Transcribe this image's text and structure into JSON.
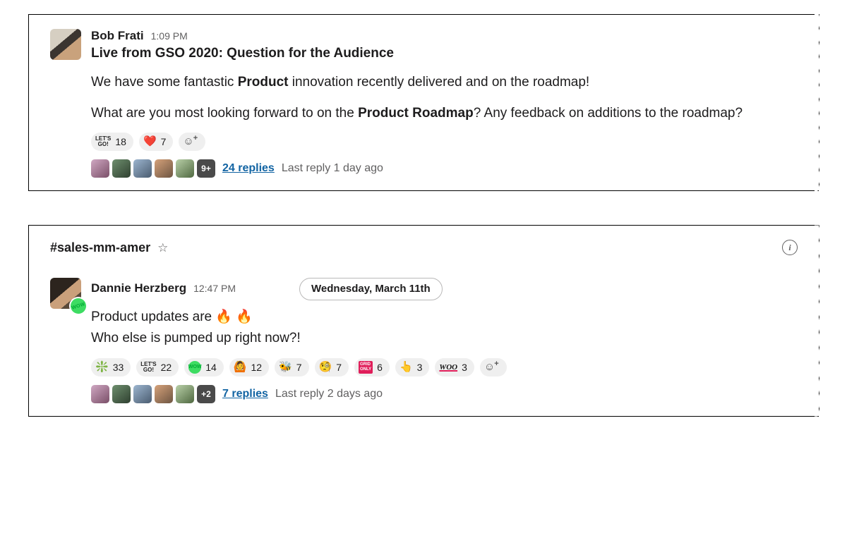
{
  "card1": {
    "author": "Bob Frati",
    "time": "1:09 PM",
    "subject": "Live from GSO 2020: Question for the Audience",
    "p1_a": "We have some fantastic ",
    "p1_b": "Product",
    "p1_c": " innovation recently delivered and on the roadmap!",
    "p2_a": "What are you most looking forward to on the ",
    "p2_b": "Product Roadmap",
    "p2_c": "? Any feedback on additions to the roadmap?",
    "reactions": {
      "letsgo_label": "LET'S\nGO!",
      "letsgo_count": "18",
      "heart_count": "7"
    },
    "thread": {
      "more_label": "9+",
      "replies": "24 replies",
      "last": "Last reply 1 day ago"
    }
  },
  "card2": {
    "channel": "#sales-mm-amer",
    "author": "Dannie Herzberg",
    "time": "12:47 PM",
    "date_pill": "Wednesday, March 11th",
    "wow_badge": "WOW",
    "line1_a": "Product updates are ",
    "line2": "Who else is pumped up right now?!",
    "reactions": {
      "sparkle_count": "33",
      "letsgo_label": "LET'S\nGO!",
      "letsgo_count": "22",
      "wow_count": "14",
      "face_count": "12",
      "bee_count": "7",
      "monocle_count": "7",
      "gridonly_label": "GRID\nONLY",
      "gridonly_count": "6",
      "this_count": "3",
      "woo_label": "WOO",
      "woo_count": "3"
    },
    "thread": {
      "more_label": "+2",
      "replies": "7 replies",
      "last": "Last reply 2 days ago"
    }
  }
}
